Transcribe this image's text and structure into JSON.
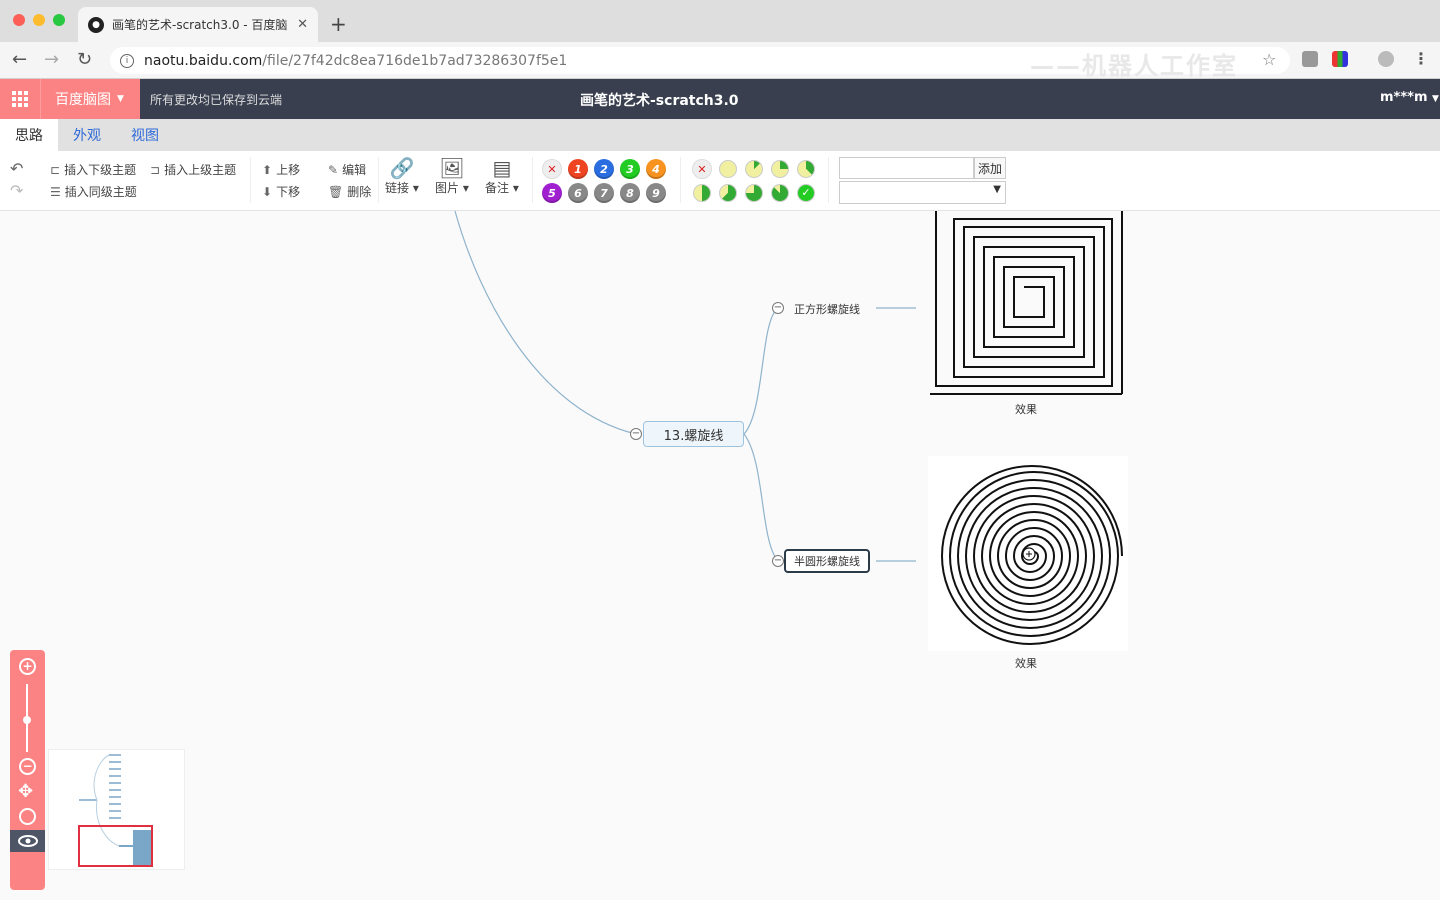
{
  "browser": {
    "tab_title": "画笔的艺术-scratch3.0 - 百度脑",
    "url_host": "naotu.baidu.com",
    "url_path": "/file/27f42dc8ea716de1b7ad73286307f5e1",
    "watermark": "——机器人工作室"
  },
  "app": {
    "brand": "百度脑图",
    "save_status": "所有更改均已保存到云端",
    "doc_title": "画笔的艺术-scratch3.0",
    "user": "m***m"
  },
  "menu_tabs": [
    "思路",
    "外观",
    "视图"
  ],
  "toolbar": {
    "insert_child": "插入下级主题",
    "insert_parent": "插入上级主题",
    "insert_sibling": "插入同级主题",
    "move_up": "上移",
    "move_down": "下移",
    "edit": "编辑",
    "delete": "删除",
    "link": "链接",
    "image": "图片",
    "note": "备注",
    "priority_labels": [
      "1",
      "2",
      "3",
      "4",
      "5",
      "6",
      "7",
      "8",
      "9"
    ],
    "resource_add": "添加"
  },
  "mindmap": {
    "main_node": "13.螺旋线",
    "child_square": "正方形螺旋线",
    "child_semicircle": "半圆形螺旋线",
    "caption_square": "效果",
    "caption_semicircle": "效果"
  },
  "colors": {
    "accent": "#fc8383",
    "header_bg": "#393f4f",
    "link_color": "#2e6ad9",
    "node_border": "#9ec3de"
  }
}
